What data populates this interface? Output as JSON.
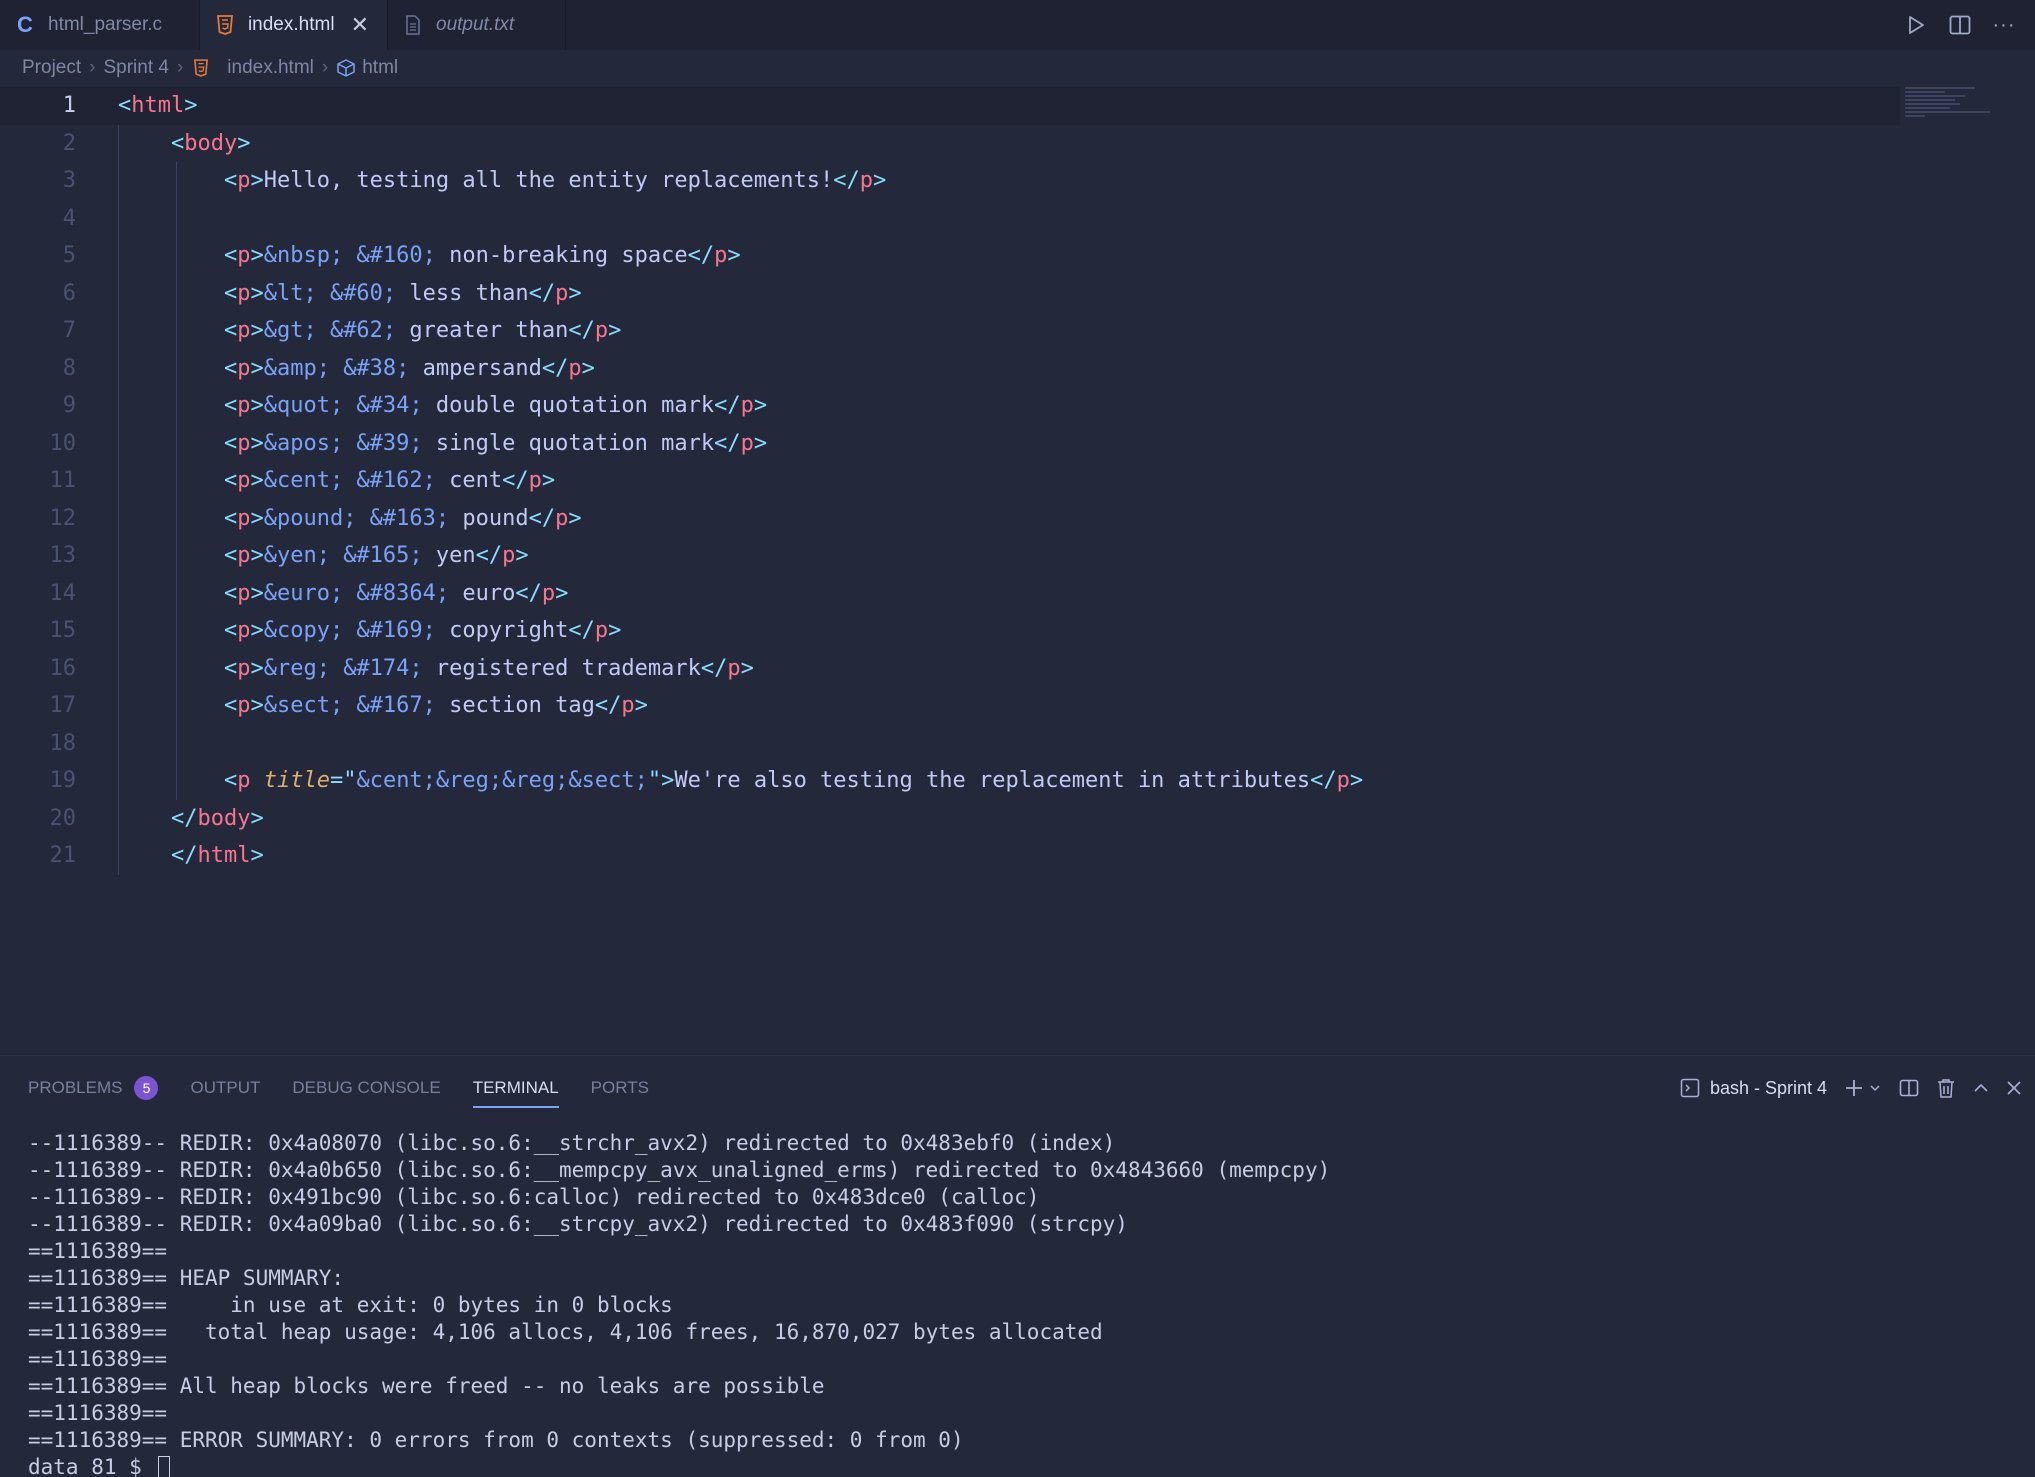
{
  "tabs": [
    {
      "label": "html_parser.c",
      "icon": "c-file-icon",
      "active": false,
      "italic": false
    },
    {
      "label": "index.html",
      "icon": "html-file-icon",
      "active": true,
      "italic": false
    },
    {
      "label": "output.txt",
      "icon": "text-file-icon",
      "active": false,
      "italic": true
    }
  ],
  "breadcrumb": {
    "project": "Project",
    "folder": "Sprint 4",
    "file": "index.html",
    "symbol": "html"
  },
  "editor": {
    "current_line": 1,
    "lines": [
      {
        "n": "1",
        "tokens": [
          [
            "br",
            "<"
          ],
          [
            "tag",
            "html"
          ],
          [
            "br",
            ">"
          ]
        ]
      },
      {
        "n": "2",
        "tokens": [
          [
            "txt",
            "    "
          ],
          [
            "br",
            "<"
          ],
          [
            "tag",
            "body"
          ],
          [
            "br",
            ">"
          ]
        ]
      },
      {
        "n": "3",
        "tokens": [
          [
            "txt",
            "        "
          ],
          [
            "br",
            "<"
          ],
          [
            "tag",
            "p"
          ],
          [
            "br",
            ">"
          ],
          [
            "txt",
            "Hello, testing all the entity replacements!"
          ],
          [
            "br",
            "</"
          ],
          [
            "tag",
            "p"
          ],
          [
            "br",
            ">"
          ]
        ]
      },
      {
        "n": "4",
        "tokens": []
      },
      {
        "n": "5",
        "tokens": [
          [
            "txt",
            "        "
          ],
          [
            "br",
            "<"
          ],
          [
            "tag",
            "p"
          ],
          [
            "br",
            ">"
          ],
          [
            "ent",
            "&nbsp; &#160;"
          ],
          [
            "txt",
            " non-breaking space"
          ],
          [
            "br",
            "</"
          ],
          [
            "tag",
            "p"
          ],
          [
            "br",
            ">"
          ]
        ]
      },
      {
        "n": "6",
        "tokens": [
          [
            "txt",
            "        "
          ],
          [
            "br",
            "<"
          ],
          [
            "tag",
            "p"
          ],
          [
            "br",
            ">"
          ],
          [
            "ent",
            "&lt; &#60;"
          ],
          [
            "txt",
            " less than"
          ],
          [
            "br",
            "</"
          ],
          [
            "tag",
            "p"
          ],
          [
            "br",
            ">"
          ]
        ]
      },
      {
        "n": "7",
        "tokens": [
          [
            "txt",
            "        "
          ],
          [
            "br",
            "<"
          ],
          [
            "tag",
            "p"
          ],
          [
            "br",
            ">"
          ],
          [
            "ent",
            "&gt; &#62;"
          ],
          [
            "txt",
            " greater than"
          ],
          [
            "br",
            "</"
          ],
          [
            "tag",
            "p"
          ],
          [
            "br",
            ">"
          ]
        ]
      },
      {
        "n": "8",
        "tokens": [
          [
            "txt",
            "        "
          ],
          [
            "br",
            "<"
          ],
          [
            "tag",
            "p"
          ],
          [
            "br",
            ">"
          ],
          [
            "ent",
            "&amp; &#38;"
          ],
          [
            "txt",
            " ampersand"
          ],
          [
            "br",
            "</"
          ],
          [
            "tag",
            "p"
          ],
          [
            "br",
            ">"
          ]
        ]
      },
      {
        "n": "9",
        "tokens": [
          [
            "txt",
            "        "
          ],
          [
            "br",
            "<"
          ],
          [
            "tag",
            "p"
          ],
          [
            "br",
            ">"
          ],
          [
            "ent",
            "&quot; &#34;"
          ],
          [
            "txt",
            " double quotation mark"
          ],
          [
            "br",
            "</"
          ],
          [
            "tag",
            "p"
          ],
          [
            "br",
            ">"
          ]
        ]
      },
      {
        "n": "10",
        "tokens": [
          [
            "txt",
            "        "
          ],
          [
            "br",
            "<"
          ],
          [
            "tag",
            "p"
          ],
          [
            "br",
            ">"
          ],
          [
            "ent",
            "&apos; &#39;"
          ],
          [
            "txt",
            " single quotation mark"
          ],
          [
            "br",
            "</"
          ],
          [
            "tag",
            "p"
          ],
          [
            "br",
            ">"
          ]
        ]
      },
      {
        "n": "11",
        "tokens": [
          [
            "txt",
            "        "
          ],
          [
            "br",
            "<"
          ],
          [
            "tag",
            "p"
          ],
          [
            "br",
            ">"
          ],
          [
            "ent",
            "&cent; &#162;"
          ],
          [
            "txt",
            " cent"
          ],
          [
            "br",
            "</"
          ],
          [
            "tag",
            "p"
          ],
          [
            "br",
            ">"
          ]
        ]
      },
      {
        "n": "12",
        "tokens": [
          [
            "txt",
            "        "
          ],
          [
            "br",
            "<"
          ],
          [
            "tag",
            "p"
          ],
          [
            "br",
            ">"
          ],
          [
            "ent",
            "&pound; &#163;"
          ],
          [
            "txt",
            " pound"
          ],
          [
            "br",
            "</"
          ],
          [
            "tag",
            "p"
          ],
          [
            "br",
            ">"
          ]
        ]
      },
      {
        "n": "13",
        "tokens": [
          [
            "txt",
            "        "
          ],
          [
            "br",
            "<"
          ],
          [
            "tag",
            "p"
          ],
          [
            "br",
            ">"
          ],
          [
            "ent",
            "&yen; &#165;"
          ],
          [
            "txt",
            " yen"
          ],
          [
            "br",
            "</"
          ],
          [
            "tag",
            "p"
          ],
          [
            "br",
            ">"
          ]
        ]
      },
      {
        "n": "14",
        "tokens": [
          [
            "txt",
            "        "
          ],
          [
            "br",
            "<"
          ],
          [
            "tag",
            "p"
          ],
          [
            "br",
            ">"
          ],
          [
            "ent",
            "&euro; &#8364;"
          ],
          [
            "txt",
            " euro"
          ],
          [
            "br",
            "</"
          ],
          [
            "tag",
            "p"
          ],
          [
            "br",
            ">"
          ]
        ]
      },
      {
        "n": "15",
        "tokens": [
          [
            "txt",
            "        "
          ],
          [
            "br",
            "<"
          ],
          [
            "tag",
            "p"
          ],
          [
            "br",
            ">"
          ],
          [
            "ent",
            "&copy; &#169;"
          ],
          [
            "txt",
            " copyright"
          ],
          [
            "br",
            "</"
          ],
          [
            "tag",
            "p"
          ],
          [
            "br",
            ">"
          ]
        ]
      },
      {
        "n": "16",
        "tokens": [
          [
            "txt",
            "        "
          ],
          [
            "br",
            "<"
          ],
          [
            "tag",
            "p"
          ],
          [
            "br",
            ">"
          ],
          [
            "ent",
            "&reg; &#174;"
          ],
          [
            "txt",
            " registered trademark"
          ],
          [
            "br",
            "</"
          ],
          [
            "tag",
            "p"
          ],
          [
            "br",
            ">"
          ]
        ]
      },
      {
        "n": "17",
        "tokens": [
          [
            "txt",
            "        "
          ],
          [
            "br",
            "<"
          ],
          [
            "tag",
            "p"
          ],
          [
            "br",
            ">"
          ],
          [
            "ent",
            "&sect; &#167;"
          ],
          [
            "txt",
            " section tag"
          ],
          [
            "br",
            "</"
          ],
          [
            "tag",
            "p"
          ],
          [
            "br",
            ">"
          ]
        ]
      },
      {
        "n": "18",
        "tokens": []
      },
      {
        "n": "19",
        "tokens": [
          [
            "txt",
            "        "
          ],
          [
            "br",
            "<"
          ],
          [
            "tag",
            "p"
          ],
          [
            "txt",
            " "
          ],
          [
            "attr",
            "title"
          ],
          [
            "op",
            "="
          ],
          [
            "op",
            "\""
          ],
          [
            "ent",
            "&cent;&reg;&reg;&sect;"
          ],
          [
            "op",
            "\""
          ],
          [
            "br",
            ">"
          ],
          [
            "txt",
            "We're also testing the replacement in attributes"
          ],
          [
            "br",
            "</"
          ],
          [
            "tag",
            "p"
          ],
          [
            "br",
            ">"
          ]
        ]
      },
      {
        "n": "20",
        "tokens": [
          [
            "txt",
            "    "
          ],
          [
            "br",
            "</"
          ],
          [
            "tag",
            "body"
          ],
          [
            "br",
            ">"
          ]
        ]
      },
      {
        "n": "21",
        "tokens": [
          [
            "txt",
            "    "
          ],
          [
            "br",
            "</"
          ],
          [
            "tag",
            "html"
          ],
          [
            "br",
            ">"
          ]
        ]
      }
    ]
  },
  "panel": {
    "tabs": [
      {
        "label": "PROBLEMS",
        "badge": "5",
        "active": false
      },
      {
        "label": "OUTPUT",
        "active": false
      },
      {
        "label": "DEBUG CONSOLE",
        "active": false
      },
      {
        "label": "TERMINAL",
        "active": true
      },
      {
        "label": "PORTS",
        "active": false
      }
    ],
    "terminal_name": "bash - Sprint 4",
    "terminal_lines": [
      "--1116389-- REDIR: 0x4a08070 (libc.so.6:__strchr_avx2) redirected to 0x483ebf0 (index)",
      "--1116389-- REDIR: 0x4a0b650 (libc.so.6:__mempcpy_avx_unaligned_erms) redirected to 0x4843660 (mempcpy)",
      "--1116389-- REDIR: 0x491bc90 (libc.so.6:calloc) redirected to 0x483dce0 (calloc)",
      "--1116389-- REDIR: 0x4a09ba0 (libc.so.6:__strcpy_avx2) redirected to 0x483f090 (strcpy)",
      "==1116389==",
      "==1116389== HEAP SUMMARY:",
      "==1116389==     in use at exit: 0 bytes in 0 blocks",
      "==1116389==   total heap usage: 4,106 allocs, 4,106 frees, 16,870,027 bytes allocated",
      "==1116389==",
      "==1116389== All heap blocks were freed -- no leaks are possible",
      "==1116389==",
      "==1116389== ERROR SUMMARY: 0 errors from 0 contexts (suppressed: 0 from 0)"
    ],
    "prompt": "data 81 $ "
  },
  "colors": {
    "background": "#23283a",
    "tag": "#f7768e",
    "bracket": "#89ddff",
    "entity": "#7aa2f7",
    "attribute": "#e0af68",
    "badge": "#7b55d0"
  }
}
